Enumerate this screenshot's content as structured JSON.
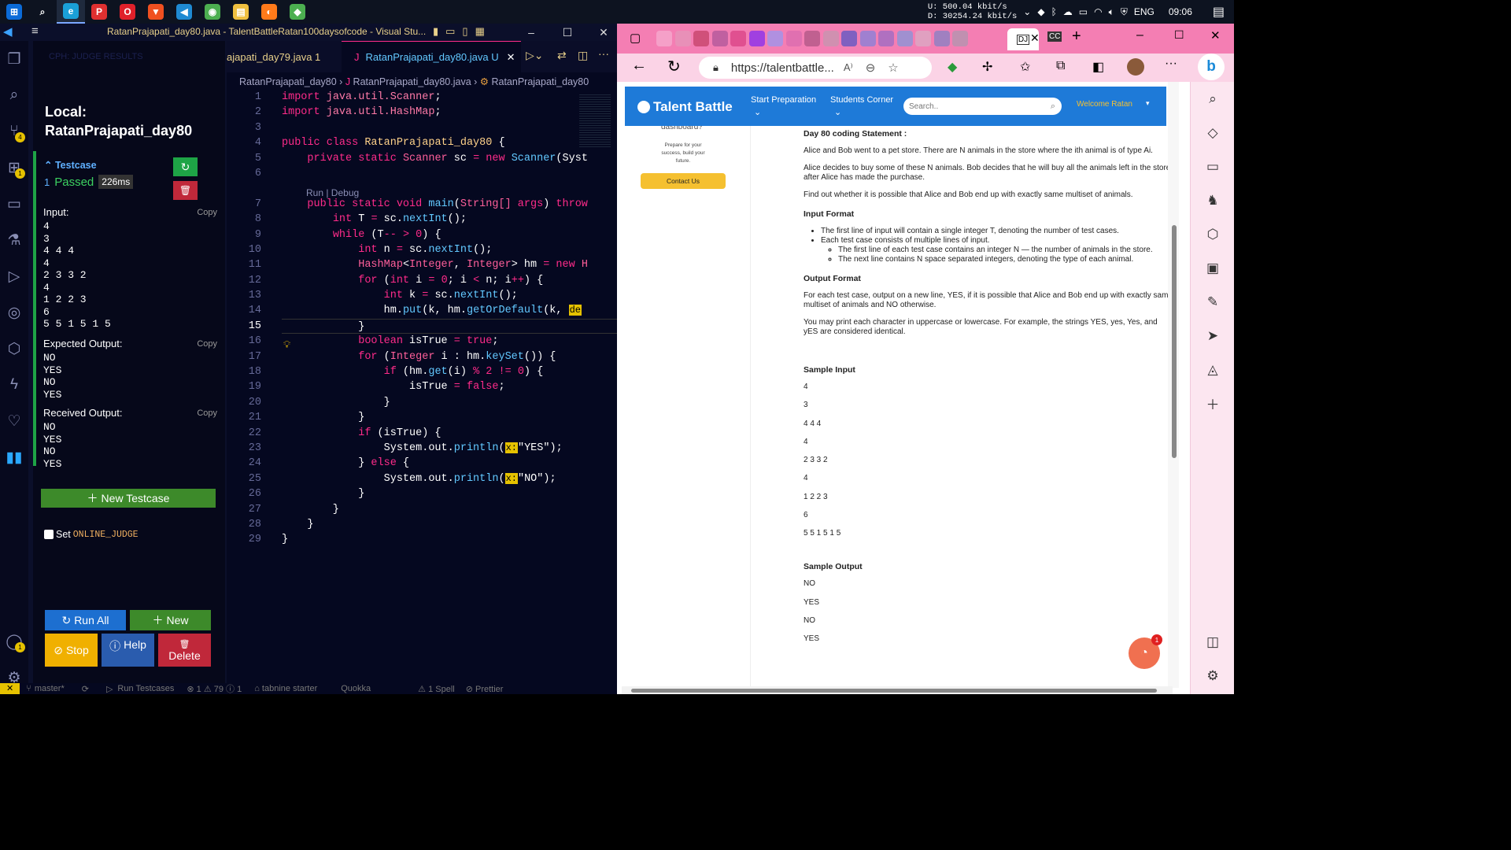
{
  "taskbar": {
    "apps": [
      {
        "name": "start",
        "glyph": "⊞",
        "color": "#0b6bd8"
      },
      {
        "name": "search",
        "glyph": "⌕",
        "color": "transparent"
      },
      {
        "name": "edge",
        "glyph": "e",
        "color": "#1aa0d8"
      },
      {
        "name": "app-p",
        "glyph": "P",
        "color": "#e03030"
      },
      {
        "name": "opera",
        "glyph": "O",
        "color": "#e0202a"
      },
      {
        "name": "brave",
        "glyph": "▼",
        "color": "#f05020"
      },
      {
        "name": "vscode",
        "glyph": "◀",
        "color": "#1f8ad2"
      },
      {
        "name": "chrome",
        "glyph": "◉",
        "color": "#4caf50"
      },
      {
        "name": "explorer",
        "glyph": "▤",
        "color": "#f0c040"
      },
      {
        "name": "firefox",
        "glyph": "◐",
        "color": "#ff7a1a"
      },
      {
        "name": "app-green",
        "glyph": "◆",
        "color": "#4caf50"
      }
    ],
    "net_up": "U:      500.04 kbit/s",
    "net_down": "D: 30254.24 kbit/s",
    "lang": "ENG",
    "time": "09:06"
  },
  "vscode": {
    "title": "RatanPrajapati_day80.java - TalentBattleRatan100daysofcode - Visual Stu...",
    "panel_header": "CPH: JUDGE RESULTS",
    "local_label": "Local:",
    "local_name": "RatanPrajapati_day80",
    "testcase": {
      "heading": "Testcase",
      "number": "1",
      "status": "Passed",
      "time": "226ms",
      "input_label": "Input:",
      "input": "4\n3\n4 4 4\n4\n2 3 3 2\n4\n1 2 2 3\n6\n5 5 1 5 1 5",
      "expected_label": "Expected Output:",
      "expected": "NO\nYES\nNO\nYES",
      "received_label": "Received Output:",
      "received": "NO\nYES\nNO\nYES",
      "copy_label": "Copy"
    },
    "new_testcase_label": "New Testcase",
    "online_judge_prefix": "Set ",
    "online_judge_code": "ONLINE_JUDGE",
    "buttons": {
      "run_all": "Run All",
      "new": "New",
      "stop": "Stop",
      "help": "Help",
      "delete": "Delete"
    },
    "tabs": [
      {
        "label": "ajapati_day79.java",
        "suffix": "1",
        "active": false
      },
      {
        "label": "RatanPrajapati_day80.java",
        "suffix": "U",
        "active": true
      }
    ],
    "breadcrumb": {
      "folder": "RatanPrajapati_day80",
      "file": "RatanPrajapati_day80.java",
      "symbol": "RatanPrajapati_day80"
    },
    "codelens": "Run | Debug",
    "statusbar": {
      "branch": "master*",
      "run_testcases": "Run Testcases",
      "problems": "⊗ 1 ⚠ 79 ⓘ 1",
      "tabnine": "⌂ tabnine starter",
      "quokka": "Quokka",
      "spell": "⚠ 1 Spell",
      "prettier": "⊘ Prettier"
    }
  },
  "browser": {
    "url": "https://talentbattle...",
    "nav": {
      "logo": "Talent Battle",
      "start_prep": "Start Preparation",
      "students_corner": "Students Corner",
      "search_placeholder": "Search..",
      "welcome": "Welcome Ratan"
    },
    "sidebar_left": {
      "dashboard_fragment": "dashboard?",
      "promo": "Prepare for your success, build your future.",
      "contact": "Contact Us"
    },
    "problem": {
      "title": "Day 80 coding Statement :",
      "p1": "Alice and Bob went to a pet store. There are N animals in the store where the ith animal is of type Ai.",
      "p2": "Alice decides to buy some of these N animals. Bob decides that he will buy all the animals left in the store after Alice has made the purchase.",
      "p3": "Find out whether it is possible that Alice and Bob end up with exactly same multiset of animals.",
      "input_format_title": "Input Format",
      "in1": "The first line of input will contain a single integer T, denoting the number of test cases.",
      "in2": "Each test case consists of multiple lines of input.",
      "in2a": "The first line of each test case contains an integer N — the number of animals in the store.",
      "in2b": "The next line contains N space separated integers, denoting the type of each animal.",
      "output_format_title": "Output Format",
      "out1": "For each test case, output on a new line, YES, if it is possible that Alice and Bob end up with exactly same multiset of animals and NO otherwise.",
      "out2": "You may print each character in uppercase or lowercase. For example, the strings YES, yes, Yes, and yES are considered identical.",
      "sample_input_title": "Sample Input",
      "sample_input": [
        "4",
        "3",
        "4 4 4",
        "4",
        "2 3 3 2",
        "4",
        "1 2 2 3",
        "6",
        "5 5 1 5 1 5"
      ],
      "sample_output_title": "Sample Output",
      "sample_output": [
        "NO",
        "YES",
        "NO",
        "YES"
      ]
    },
    "chat_badge": "1"
  }
}
